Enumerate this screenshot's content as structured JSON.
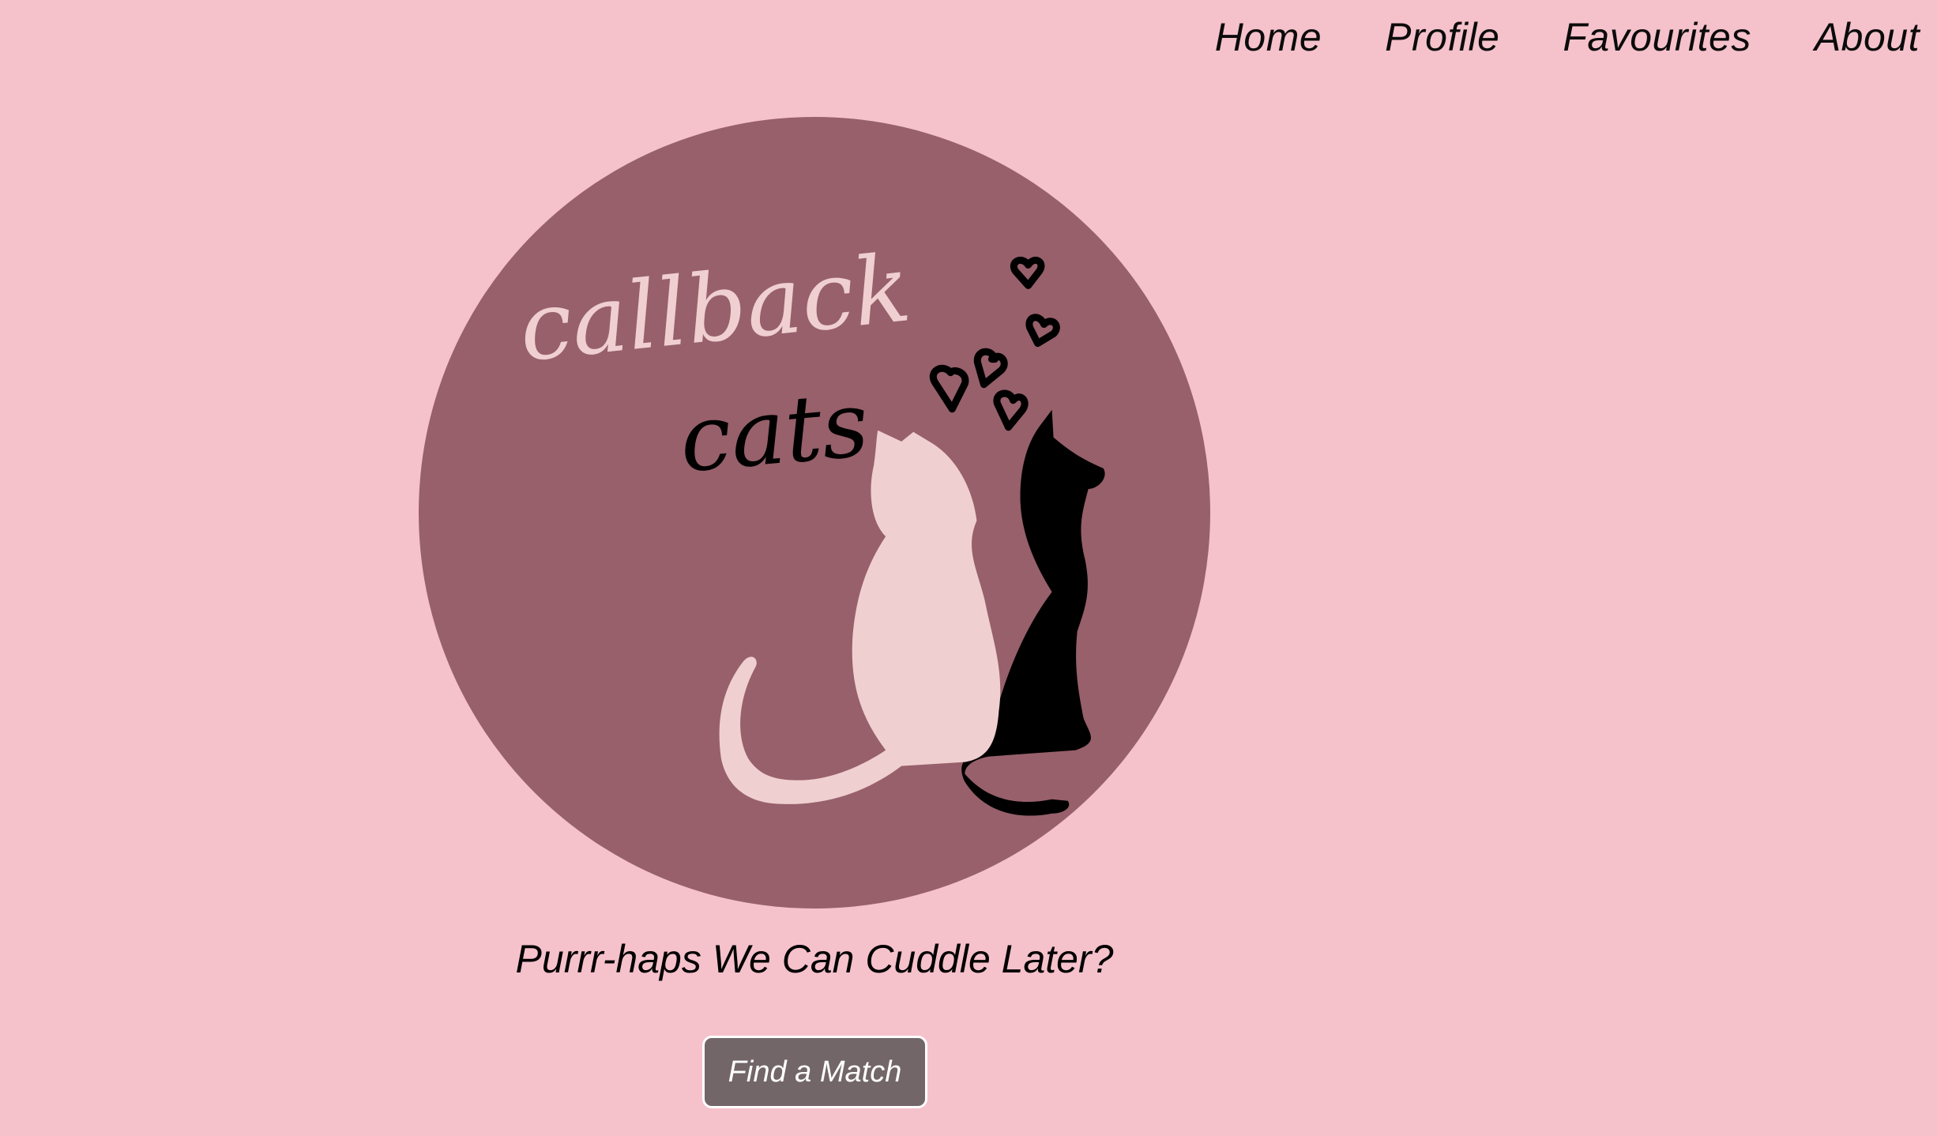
{
  "nav": {
    "items": [
      {
        "label": "Home"
      },
      {
        "label": "Profile"
      },
      {
        "label": "Favourites"
      },
      {
        "label": "About"
      }
    ]
  },
  "logo": {
    "word1": "callback",
    "word2": "cats",
    "icon": "two-cats-with-hearts-logo",
    "colors": {
      "circle": "#97606b",
      "light": "#f0cfd0",
      "dark": "#000000"
    }
  },
  "hero": {
    "tagline": "Purrr-haps We Can Cuddle Later?",
    "cta_label": "Find a Match"
  },
  "colors": {
    "background": "#f5c1cb",
    "button": "#726669",
    "button_border": "#ffffff",
    "text": "#000000"
  }
}
